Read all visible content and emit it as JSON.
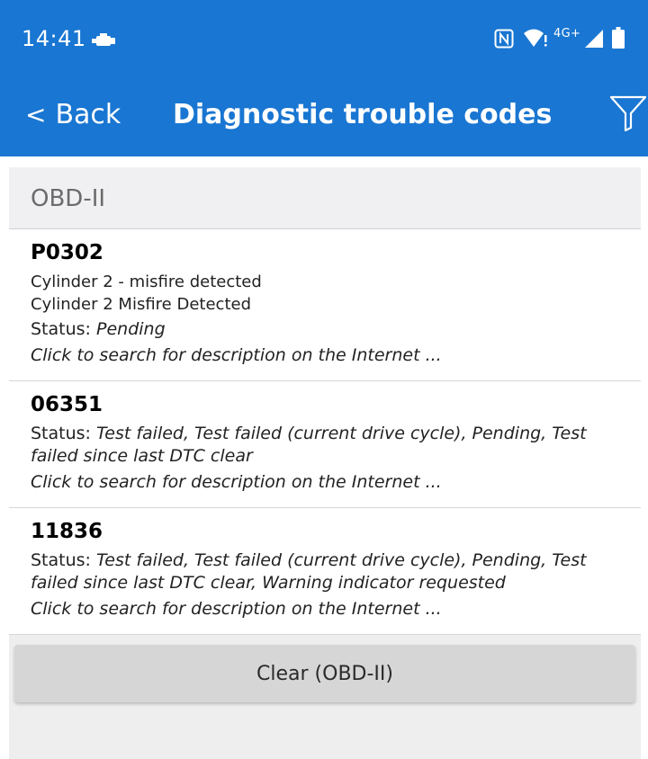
{
  "status_bar": {
    "time": "14:41",
    "network": "4G+"
  },
  "toolbar": {
    "back_label": "Back",
    "title": "Diagnostic trouble codes"
  },
  "section": {
    "title": "OBD-II"
  },
  "dtcs": [
    {
      "code": "P0302",
      "descriptions": [
        "Cylinder 2 - misfire detected",
        "Cylinder 2 Misfire Detected"
      ],
      "status_label": "Status:",
      "status": "Pending",
      "link": "Click to search for description on the Internet ..."
    },
    {
      "code": "06351",
      "descriptions": [],
      "status_label": "Status:",
      "status": "Test failed, Test failed (current drive cycle), Pending, Test failed since last DTC clear",
      "link": "Click to search for description on the Internet ..."
    },
    {
      "code": "11836",
      "descriptions": [],
      "status_label": "Status:",
      "status": "Test failed, Test failed (current drive cycle), Pending, Test failed since last DTC clear, Warning indicator requested",
      "link": "Click to search for description on the Internet ..."
    }
  ],
  "clear_button": {
    "label": "Clear (OBD-II)"
  },
  "colors": {
    "primary": "#1976d2",
    "button_gray": "#d6d6d6",
    "section_bg": "#f0f0f2"
  },
  "icons": [
    "engine-icon",
    "nfc-icon",
    "wifi-icon",
    "signal-icon",
    "battery-icon",
    "chevron-left-icon",
    "filter-icon"
  ]
}
